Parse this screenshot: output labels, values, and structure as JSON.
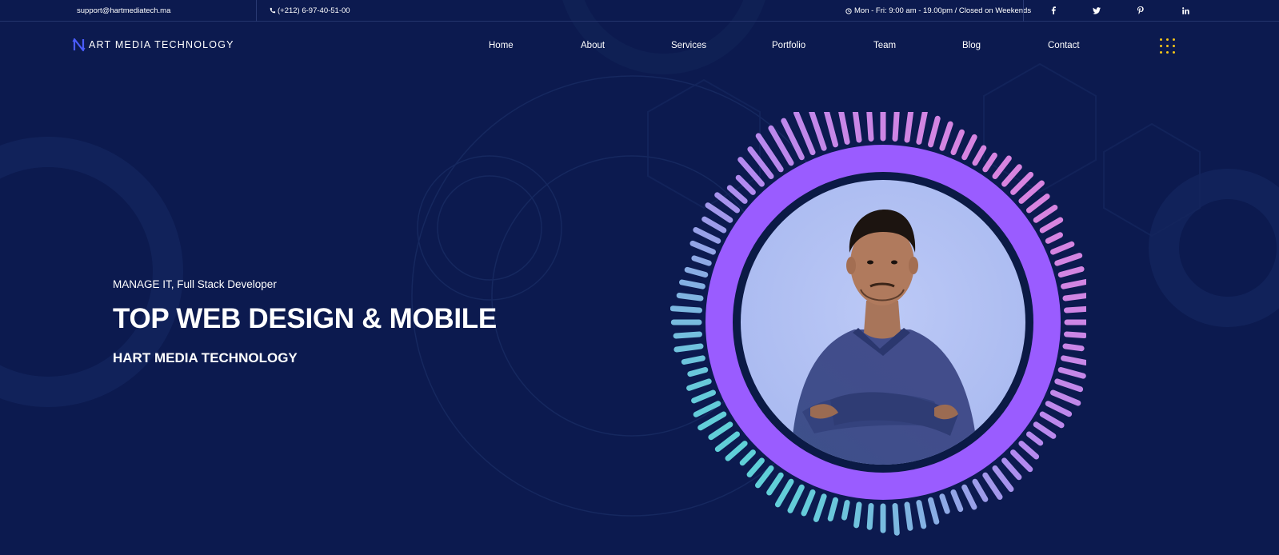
{
  "topbar": {
    "email": "support@hartmediatech.ma",
    "phone": "(+212) 6-97-40-51-00",
    "hours": "Mon - Fri: 9:00 am - 19.00pm / Closed on Weekends",
    "social": [
      "facebook-icon",
      "twitter-icon",
      "pinterest-icon",
      "linkedin-icon"
    ]
  },
  "brand": {
    "logo_letter": "N",
    "name": "ART MEDIA TECHNOLOGY",
    "logo_color": "#4a5cff"
  },
  "nav": {
    "items": [
      "Home",
      "About",
      "Services",
      "Portfolio",
      "Team",
      "Blog",
      "Contact"
    ],
    "menu_icon": "dots-grid-icon",
    "menu_color": "#f5c518"
  },
  "hero": {
    "subtitle": "MANAGE IT, Full Stack Developer",
    "title": "TOP WEB DESIGN & MOBILE",
    "company": "HART MEDIA TECHNOLOGY",
    "ring_color": "#9a5cff",
    "bar_colors": [
      "#5fd0d8",
      "#b38af0",
      "#d884e0"
    ]
  },
  "colors": {
    "background": "#0c1a4f",
    "accent": "#9a5cff"
  }
}
